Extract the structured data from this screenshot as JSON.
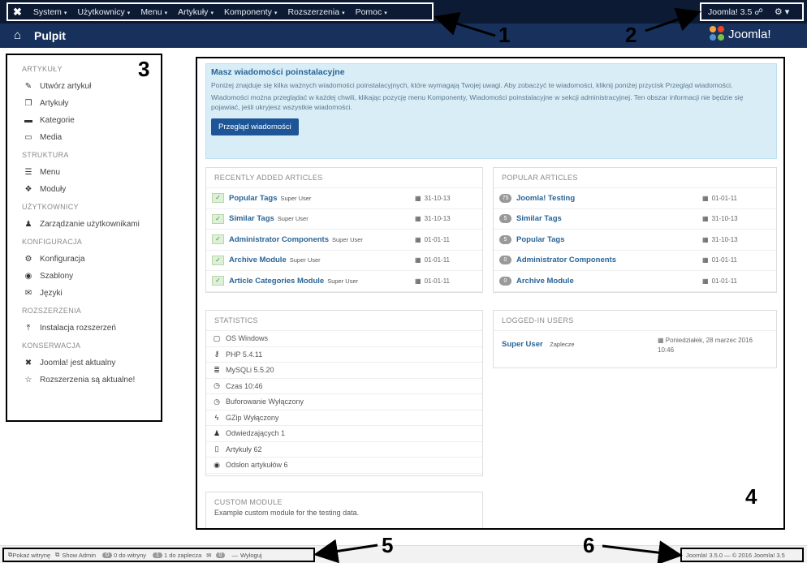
{
  "topbar": {
    "menu": [
      "System",
      "Użytkownicy",
      "Menu",
      "Artykuły",
      "Komponenty",
      "Rozszerzenia",
      "Pomoc"
    ],
    "version_link": "Joomla! 3.5 ☍",
    "settings_icon": "gear-icon"
  },
  "subheader": {
    "title": "Pulpit",
    "brand": "Joomla!"
  },
  "callouts": [
    "1",
    "2",
    "3",
    "4",
    "5",
    "6"
  ],
  "sidebar": {
    "sections": [
      {
        "title": "ARTYKUŁY",
        "items": [
          {
            "label": "Utwórz artykuł",
            "icon": "pencil-icon"
          },
          {
            "label": "Artykuły",
            "icon": "copy-icon"
          },
          {
            "label": "Kategorie",
            "icon": "folder-icon"
          },
          {
            "label": "Media",
            "icon": "image-icon"
          }
        ]
      },
      {
        "title": "STRUKTURA",
        "items": [
          {
            "label": "Menu",
            "icon": "list-icon"
          },
          {
            "label": "Moduły",
            "icon": "cube-icon"
          }
        ]
      },
      {
        "title": "UŻYTKOWNICY",
        "items": [
          {
            "label": "Zarządzanie użytkownikami",
            "icon": "users-icon"
          }
        ]
      },
      {
        "title": "KONFIGURACJA",
        "items": [
          {
            "label": "Konfiguracja",
            "icon": "cog-icon"
          },
          {
            "label": "Szablony",
            "icon": "eye-icon"
          },
          {
            "label": "Języki",
            "icon": "comments-icon"
          }
        ]
      },
      {
        "title": "ROZSZERZENIA",
        "items": [
          {
            "label": "Instalacja rozszerzeń",
            "icon": "upload-icon"
          }
        ]
      },
      {
        "title": "KONSERWACJA",
        "items": [
          {
            "label": "Joomla! jest aktualny",
            "icon": "joomla-icon"
          },
          {
            "label": "Rozszerzenia są aktualne!",
            "icon": "star-icon"
          }
        ]
      }
    ]
  },
  "notice": {
    "title": "Masz wiadomości poinstalacyjne",
    "p1": "Poniżej znajduje się kilka ważnych wiadomości poinstalacyjnych, które wymagają Twojej uwagi. Aby zobaczyć te wiadomości, kliknij poniżej przycisk Przegląd wiadomości.",
    "p2": "Wiadomości można przeglądać w każdej chwili, klikając pozycję menu Komponenty, Wiadomości poinstalacyjne w sekcji administracyjnej. Ten obszar informacji nie będzie się pojawiać, jeśli ukryjesz wszystkie wiadomości.",
    "button": "Przegląd wiadomości"
  },
  "recent": {
    "title": "RECENTLY ADDED ARTICLES",
    "rows": [
      {
        "title": "Popular Tags",
        "author": "Super User",
        "date": "31-10-13"
      },
      {
        "title": "Similar Tags",
        "author": "Super User",
        "date": "31-10-13"
      },
      {
        "title": "Administrator Components",
        "author": "Super User",
        "date": "01-01-11"
      },
      {
        "title": "Archive Module",
        "author": "Super User",
        "date": "01-01-11"
      },
      {
        "title": "Article Categories Module",
        "author": "Super User",
        "date": "01-01-11"
      }
    ]
  },
  "popular": {
    "title": "POPULAR ARTICLES",
    "rows": [
      {
        "hits": "75",
        "title": "Joomla! Testing",
        "date": "01-01-11"
      },
      {
        "hits": "5",
        "title": "Similar Tags",
        "date": "31-10-13"
      },
      {
        "hits": "5",
        "title": "Popular Tags",
        "date": "31-10-13"
      },
      {
        "hits": "0",
        "title": "Administrator Components",
        "date": "01-01-11"
      },
      {
        "hits": "0",
        "title": "Archive Module",
        "date": "01-01-11"
      }
    ]
  },
  "statistics": {
    "title": "STATISTICS",
    "rows": [
      {
        "label": "OS Windows",
        "icon": "monitor-icon"
      },
      {
        "label": "PHP 5.4.11",
        "icon": "key-icon"
      },
      {
        "label": "MySQLi 5.5.20",
        "icon": "database-icon"
      },
      {
        "label": "Czas 10:46",
        "icon": "clock-icon"
      },
      {
        "label": "Buforowanie Wyłączony",
        "icon": "clock-icon"
      },
      {
        "label": "GZip Wyłączony",
        "icon": "lightning-icon"
      },
      {
        "label": "Odwiedzających 1",
        "icon": "users-icon"
      },
      {
        "label": "Artykuły 62",
        "icon": "file-icon"
      },
      {
        "label": "Odsłon artykułów 6",
        "icon": "eye-icon"
      }
    ]
  },
  "logged": {
    "title": "LOGGED-IN USERS",
    "user": "Super User",
    "area": "Zaplecze",
    "time_line1": "Poniedziałek, 28 marzec 2016",
    "time_line2": "10:46"
  },
  "custom": {
    "title": "CUSTOM MODULE",
    "text": "Example custom module for the testing data."
  },
  "footer": {
    "preview": "Pokaż witrynę",
    "admin": "Show Admin",
    "site_count": "0",
    "site_label": "0 do witryny",
    "admin_count": "1",
    "admin_label": "1 do zaplecza",
    "mail_count": "0",
    "logout": "Wyloguj",
    "copyright": "Joomla! 3.5.0 — © 2016 Joomla! 3.5"
  }
}
